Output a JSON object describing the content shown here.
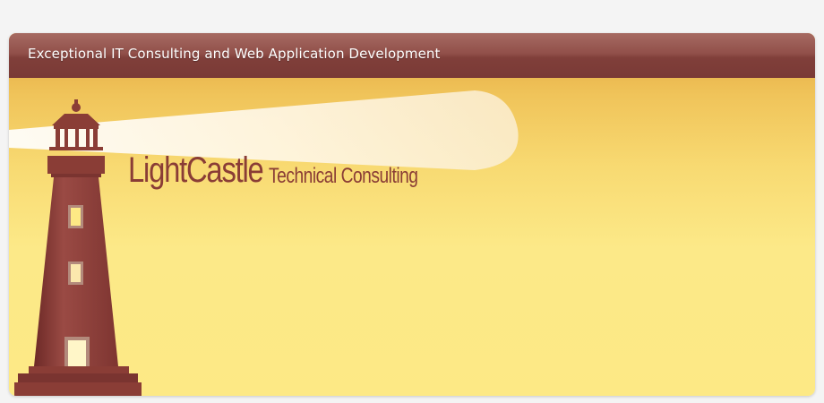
{
  "header": {
    "tagline": "Exceptional IT Consulting and Web Application Development"
  },
  "logo": {
    "name": "LightCastle",
    "subtitle": "Technical Consulting"
  },
  "colors": {
    "brand_maroon": "#8a3d36",
    "header_bar": "#91504a",
    "background_gold": "#f0c45a",
    "background_light_yellow": "#fde985",
    "beam": "#fff6e4"
  },
  "icons": {
    "lighthouse": "lighthouse-icon",
    "light_beam": "light-beam"
  }
}
